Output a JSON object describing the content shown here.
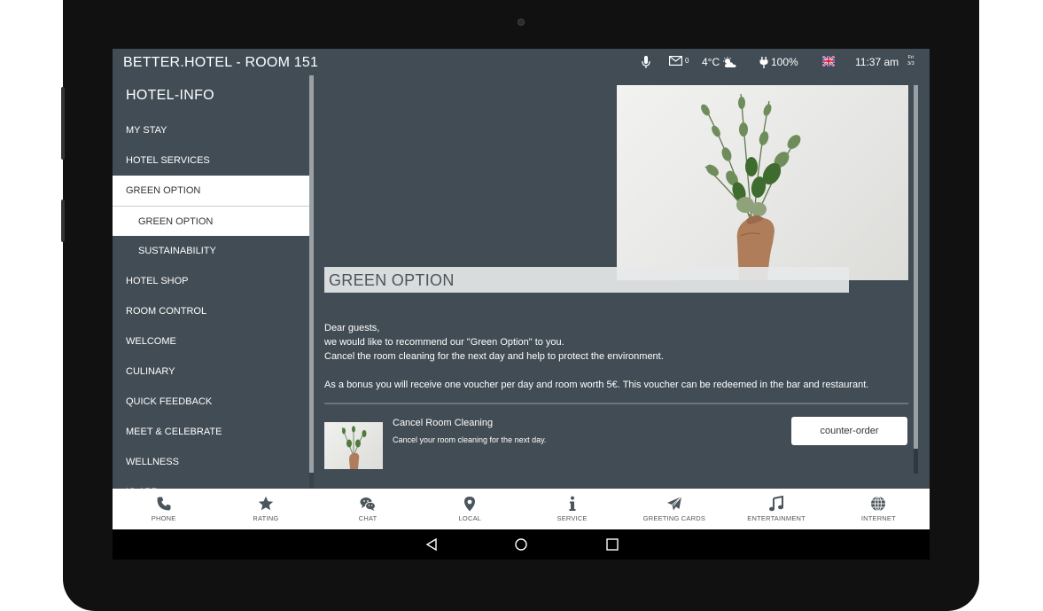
{
  "statusbar": {
    "title": "BETTER.HOTEL - ROOM 151",
    "messages_count": "0",
    "temperature": "4°C",
    "battery": "100%",
    "time": "11:37 am",
    "date_top": "Fri",
    "date_bottom": "3/3"
  },
  "sidebar": {
    "heading": "HOTEL-INFO",
    "items": [
      {
        "label": "MY STAY"
      },
      {
        "label": "HOTEL SERVICES"
      },
      {
        "label": "GREEN OPTION"
      },
      {
        "label": "GREEN OPTION"
      },
      {
        "label": "SUSTAINABILITY"
      },
      {
        "label": "HOTEL SHOP"
      },
      {
        "label": "ROOM CONTROL"
      },
      {
        "label": "WELCOME"
      },
      {
        "label": "CULINARY"
      },
      {
        "label": "QUICK FEEDBACK"
      },
      {
        "label": "MEET & CELEBRATE"
      },
      {
        "label": "WELLNESS"
      },
      {
        "label": "IQ APP"
      }
    ]
  },
  "main": {
    "title": "GREEN OPTION",
    "intro": [
      "Dear guests,",
      "we would like to recommend our \"Green Option\" to you.",
      "Cancel the room cleaning for the next day and help to protect the environment.",
      "As a bonus you will receive one voucher per day and room worth 5€. This voucher can be redeemed in the bar and restaurant."
    ],
    "offer": {
      "title": "Cancel Room Cleaning",
      "description": "Cancel your room cleaning for the next day.",
      "button": "counter-order"
    }
  },
  "bottom_nav": [
    {
      "label": "PHONE",
      "icon": "phone-icon"
    },
    {
      "label": "RATING",
      "icon": "star-icon"
    },
    {
      "label": "CHAT",
      "icon": "chat-icon"
    },
    {
      "label": "LOCAL",
      "icon": "map-pin-icon"
    },
    {
      "label": "SERVICE",
      "icon": "info-icon"
    },
    {
      "label": "GREETING CARDS",
      "icon": "paper-plane-icon"
    },
    {
      "label": "ENTERTAINMENT",
      "icon": "music-note-icon"
    },
    {
      "label": "INTERNET",
      "icon": "globe-icon"
    }
  ],
  "colors": {
    "background": "#414c54",
    "highlight": "#ffffff",
    "text": "#ffffff"
  }
}
